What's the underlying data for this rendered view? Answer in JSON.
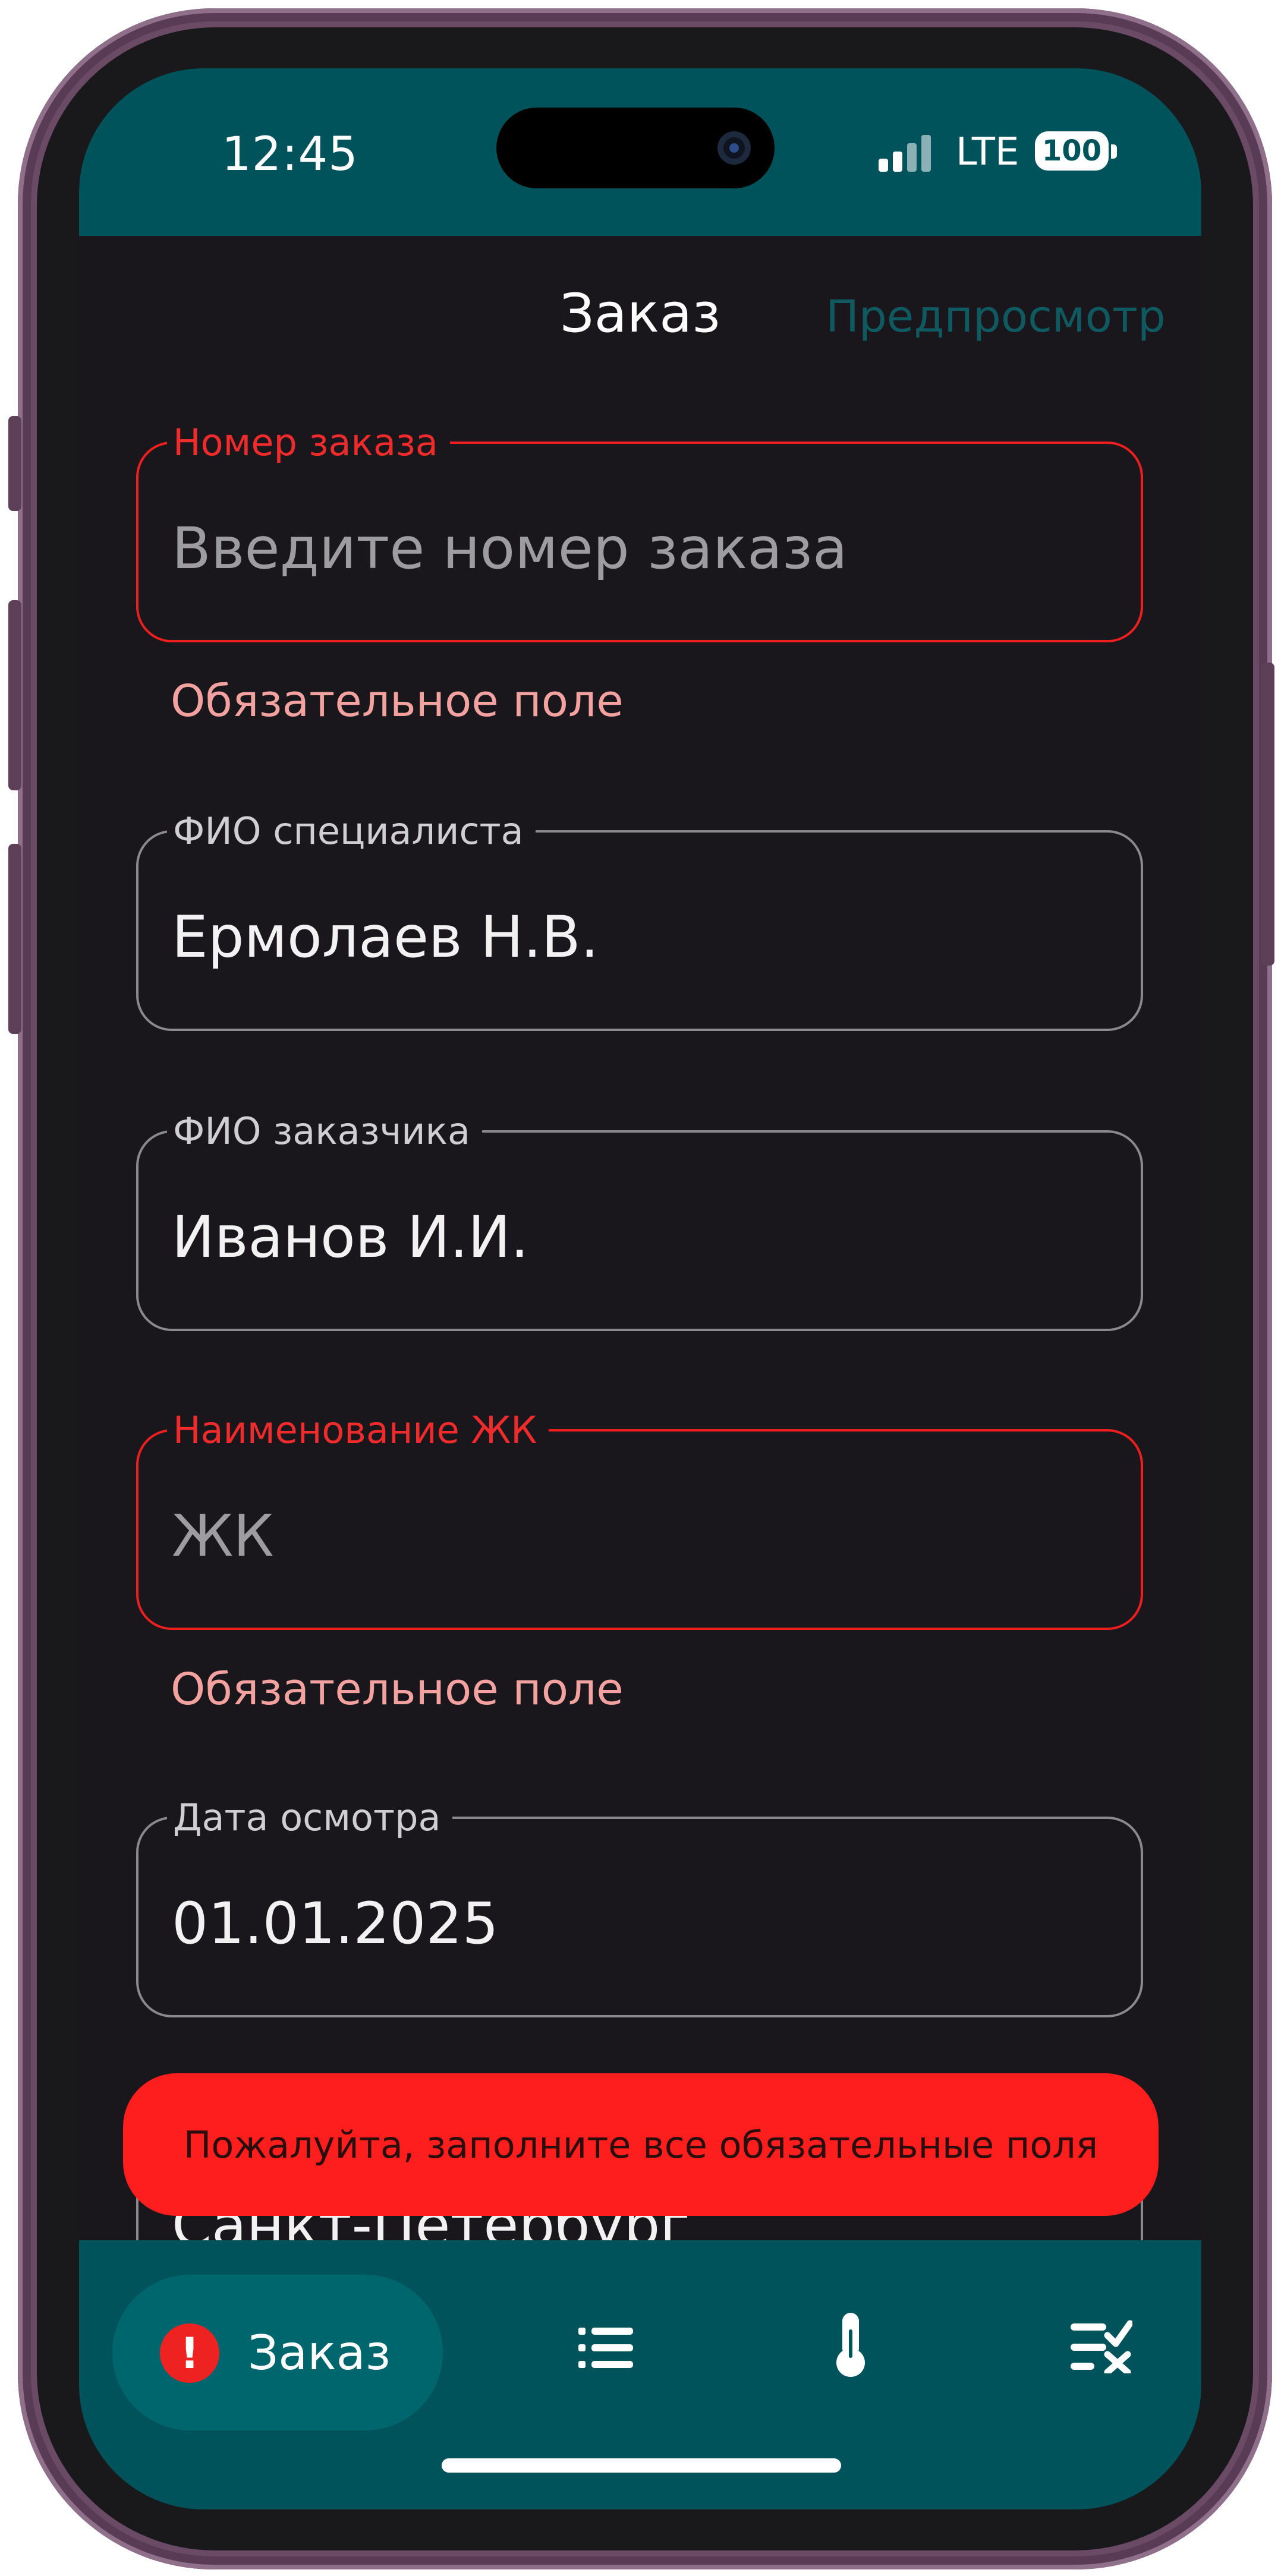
{
  "status_bar": {
    "time": "12:45",
    "network": "LTE",
    "battery": "100"
  },
  "header": {
    "title": "Заказ",
    "preview_link": "Предпросмотр"
  },
  "form": {
    "order_number": {
      "label": "Номер заказа",
      "placeholder": "Введите номер заказа",
      "error": "Обязательное поле"
    },
    "specialist": {
      "label": "ФИО специалиста",
      "value": "Ермолаев Н.В."
    },
    "customer": {
      "label": "ФИО заказчика",
      "value": "Иванов И.И."
    },
    "complex_name": {
      "label": "Наименование ЖК",
      "placeholder": "ЖК",
      "error": "Обязательное поле"
    },
    "inspection_date": {
      "label": "Дата осмотра",
      "value": "01.01.2025"
    },
    "city": {
      "value": "Санкт-Петербург"
    }
  },
  "toast": {
    "message": "Пожалуйта, заполните все обязательные поля"
  },
  "bottom_nav": {
    "items": [
      {
        "label": "Заказ",
        "icon": "alert-icon",
        "active": true
      },
      {
        "label": "",
        "icon": "list-icon",
        "active": false
      },
      {
        "label": "",
        "icon": "thermometer-icon",
        "active": false
      },
      {
        "label": "",
        "icon": "checklist-icon",
        "active": false
      }
    ]
  },
  "colors": {
    "accent": "#00535b",
    "error": "#ef1f1f",
    "error_hint": "#f3a2a0",
    "toast": "#fe1e1e",
    "background": "#19171b"
  }
}
